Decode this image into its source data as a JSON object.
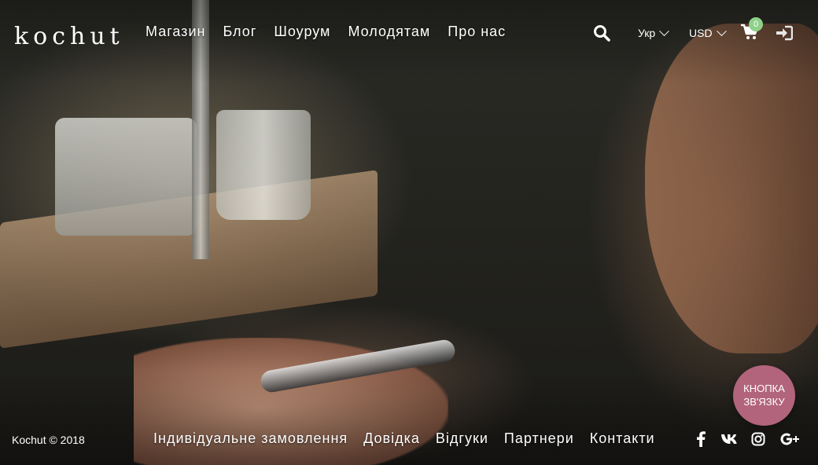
{
  "header": {
    "logo_text": "kochut",
    "nav": [
      "Магазин",
      "Блог",
      "Шоурум",
      "Молодятам",
      "Про нас"
    ],
    "language": "Укр",
    "currency": "USD",
    "cart_count": "0"
  },
  "footer": {
    "copyright": "Kochut © 2018",
    "nav": [
      "Індивідуальне замовлення",
      "Довідка",
      "Відгуки",
      "Партнери",
      "Контакти"
    ],
    "contact_button": {
      "line1": "КНОПКА",
      "line2": "ЗВ'ЯЗКУ"
    },
    "social": [
      "facebook-icon",
      "vk-icon",
      "instagram-icon",
      "google-plus-icon"
    ]
  },
  "colors": {
    "accent_pink": "#b2647d",
    "badge_green": "#8fd08a"
  }
}
